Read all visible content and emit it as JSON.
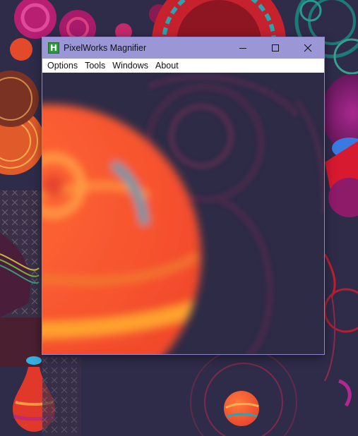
{
  "window": {
    "title": "PixelWorks Magnifier",
    "icon_letter": "H",
    "minimize_icon": "minimize-icon",
    "maximize_icon": "maximize-icon",
    "close_icon": "close-icon"
  },
  "menu": {
    "items": [
      "Options",
      "Tools",
      "Windows",
      "About"
    ]
  },
  "colors": {
    "titlebar": "#9b97d6",
    "window_border": "#8c87d0",
    "menubar": "#ffffff",
    "desktop_bg": "#2f2c4a",
    "app_icon": "#2f9a3b"
  }
}
